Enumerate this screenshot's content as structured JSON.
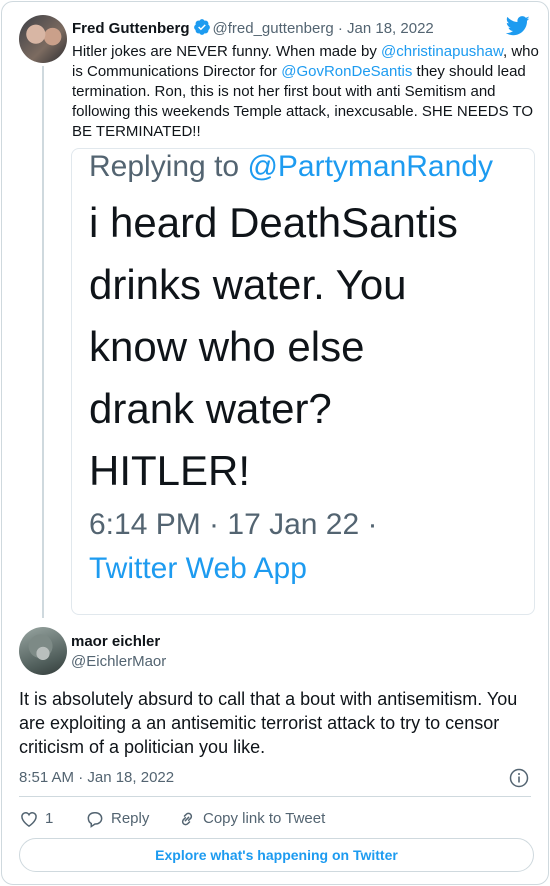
{
  "tweet": {
    "author_name": "Fred Guttenberg",
    "handle": "@fred_guttenberg",
    "separator": "·",
    "date": "Jan 18, 2022",
    "icons": [
      "verified-badge-icon",
      "twitter-bird-icon"
    ],
    "text_parts": [
      {
        "text": "Hitler jokes are NEVER funny.  When made by ",
        "link": false
      },
      {
        "text": "@christinapushaw",
        "link": true
      },
      {
        "text": ", who is Communications Director for ",
        "link": false
      },
      {
        "text": "@GovRonDeSantis",
        "link": true
      },
      {
        "text": " they should lead termination.  Ron, this is not her first bout with anti Semitism and following this weekends Temple attack, inexcusable. SHE NEEDS TO BE TERMINATED!!",
        "link": false
      }
    ],
    "media": {
      "replying_prefix": "Replying to ",
      "replying_handle": "@PartymanRandy",
      "body_lines": [
        "i heard DeathSantis",
        "drinks water. You",
        "know who else",
        "drank water?",
        "HITLER!"
      ],
      "timestamp": "6:14 PM · 17 Jan 22 ·",
      "source": "Twitter Web App"
    }
  },
  "reply": {
    "author_name": "maor eichler",
    "handle": "@EichlerMaor",
    "text": "It is absolutely absurd to call that a bout with antisemitism. You are exploiting a an antisemitic terrorist attack to try to censor criticism of a politician you like.",
    "timestamp": "8:51 AM · Jan 18, 2022",
    "like_count": "1",
    "reply_label": "Reply",
    "copy_link_label": "Copy link to Tweet",
    "explore_label": "Explore what's happening on Twitter",
    "icons": [
      "heart-icon",
      "reply-bubble-icon",
      "link-icon",
      "info-icon"
    ]
  },
  "colors": {
    "link": "#1d9bf0",
    "muted": "#536471",
    "border": "#cfd9de",
    "text": "#0f1419"
  }
}
